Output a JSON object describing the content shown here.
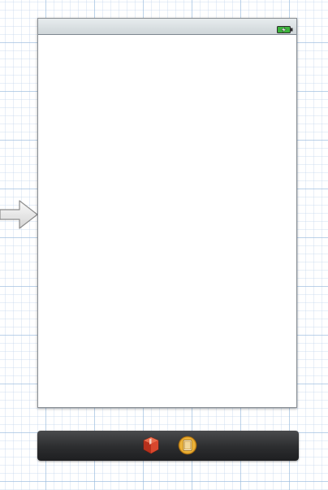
{
  "canvas": {
    "background": "#ffffff",
    "grid_color": "#b4cbe3"
  },
  "entry_arrow": {
    "icon": "initial-scene-arrow-icon"
  },
  "scene": {
    "status_bar": {
      "battery_icon": "battery-charging-icon",
      "battery_color": "#3cb43c"
    },
    "view_background": "#ffffff"
  },
  "scene_dock": {
    "items": [
      {
        "icon": "first-responder-icon",
        "color": "#d7402a"
      },
      {
        "icon": "view-controller-icon",
        "color": "#e3a92a"
      }
    ]
  }
}
